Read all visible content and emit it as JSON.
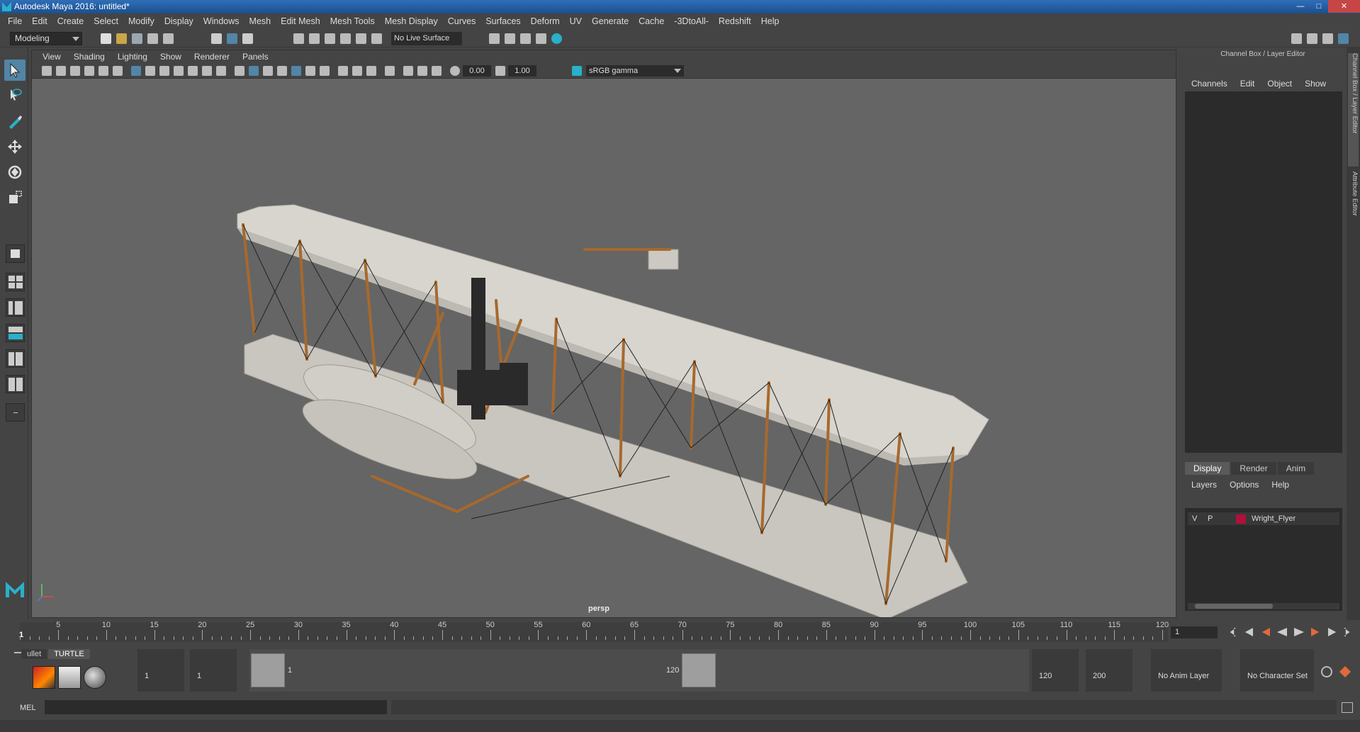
{
  "window": {
    "title": "Autodesk Maya 2016: untitled*"
  },
  "menubar": {
    "items": [
      "File",
      "Edit",
      "Create",
      "Select",
      "Modify",
      "Display",
      "Windows",
      "Mesh",
      "Edit Mesh",
      "Mesh Tools",
      "Mesh Display",
      "Curves",
      "Surfaces",
      "Deform",
      "UV",
      "Generate",
      "Cache",
      "-3DtoAll-",
      "Redshift",
      "Help"
    ]
  },
  "toolbar": {
    "mode": "Modeling",
    "live_surface": "No Live Surface"
  },
  "viewport": {
    "menu": [
      "View",
      "Shading",
      "Lighting",
      "Show",
      "Renderer",
      "Panels"
    ],
    "exposure": "0.00",
    "gamma": "1.00",
    "color_space": "sRGB gamma",
    "camera": "persp"
  },
  "channel_box": {
    "title": "Channel Box / Layer Editor",
    "menu": [
      "Channels",
      "Edit",
      "Object",
      "Show"
    ]
  },
  "layer_editor": {
    "tabs": [
      "Display",
      "Render",
      "Anim"
    ],
    "active_tab": "Display",
    "menu": [
      "Layers",
      "Options",
      "Help"
    ],
    "layers": [
      {
        "visible": "V",
        "playback": "P",
        "name": "Wright_Flyer",
        "color": "#b0103a"
      }
    ]
  },
  "side_tabs": [
    "Channel Box / Layer Editor",
    "Attribute Editor"
  ],
  "time_slider": {
    "ticks": [
      5,
      10,
      15,
      20,
      25,
      30,
      35,
      40,
      45,
      50,
      55,
      60,
      65,
      70,
      75,
      80,
      85,
      90,
      95,
      100,
      105,
      110,
      115,
      120
    ],
    "current_frame": "1",
    "frame_field": "1"
  },
  "range_slider": {
    "shelf_tabs": [
      "ullet",
      "TURTLE"
    ],
    "active_shelf": "TURTLE",
    "start_frame": "1",
    "range_start": "1",
    "range_min_label": "1",
    "range_max_label": "120",
    "range_end": "120",
    "end_frame": "200",
    "anim_layer": "No Anim Layer",
    "character_set": "No Character Set"
  },
  "command_line": {
    "label": "MEL"
  },
  "colors": {
    "accent": "#5285a6",
    "title_bar": "#1c4f8e",
    "viewport_bg": "#656565"
  }
}
